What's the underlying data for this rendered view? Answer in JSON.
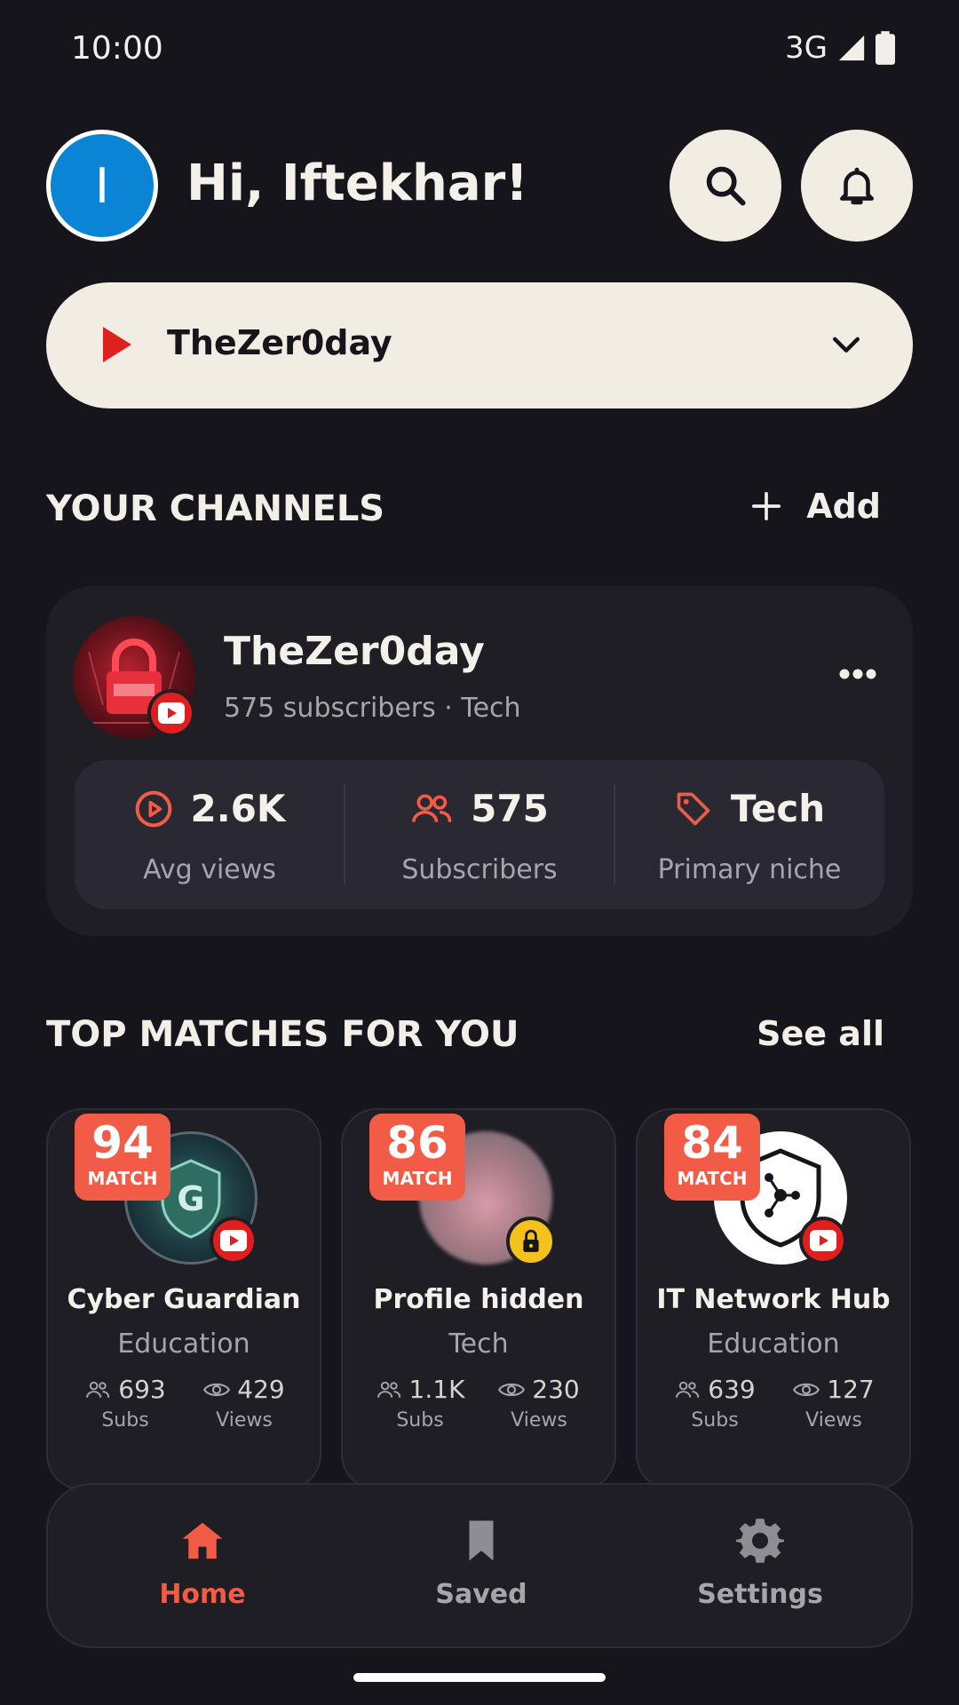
{
  "status_bar": {
    "time": "10:00",
    "network": "3G"
  },
  "header": {
    "avatar_letter": "I",
    "greeting": "Hi, Iftekhar!"
  },
  "selector": {
    "label": "TheZer0day"
  },
  "your_channels": {
    "title": "YOUR CHANNELS",
    "add_label": "Add",
    "card": {
      "name": "TheZer0day",
      "meta": "575 subscribers · Tech",
      "stats": [
        {
          "value": "2.6K",
          "label": "Avg views",
          "icon": "play-circle-icon"
        },
        {
          "value": "575",
          "label": "Subscribers",
          "icon": "users-icon"
        },
        {
          "value": "Tech",
          "label": "Primary niche",
          "icon": "tag-icon"
        }
      ]
    }
  },
  "top_matches": {
    "title": "TOP MATCHES FOR YOU",
    "see_all": "See all",
    "items": [
      {
        "score": "94",
        "match_word": "MATCH",
        "name": "Cyber Guardian",
        "niche": "Education",
        "subs": "693",
        "subs_label": "Subs",
        "views": "429",
        "views_label": "Views"
      },
      {
        "score": "86",
        "match_word": "MATCH",
        "name": "Profile hidden",
        "niche": "Tech",
        "subs": "1.1K",
        "subs_label": "Subs",
        "views": "230",
        "views_label": "Views"
      },
      {
        "score": "84",
        "match_word": "MATCH",
        "name": "IT Network Hub",
        "niche": "Education",
        "subs": "639",
        "subs_label": "Subs",
        "views": "127",
        "views_label": "Views"
      }
    ]
  },
  "bottom_nav": {
    "items": [
      {
        "label": "Home",
        "icon": "home-icon",
        "active": true
      },
      {
        "label": "Saved",
        "icon": "bookmark-icon",
        "active": false
      },
      {
        "label": "Settings",
        "icon": "gear-icon",
        "active": false
      }
    ]
  },
  "colors": {
    "accent": "#f25c46",
    "background": "#16151b",
    "card": "#1f1e25",
    "light_button": "#f1ede3",
    "youtube_red": "#e01e1e"
  }
}
